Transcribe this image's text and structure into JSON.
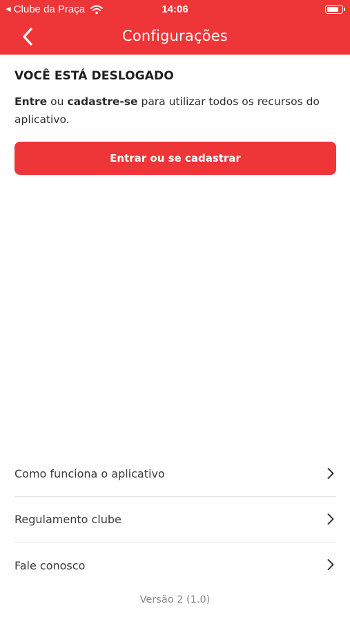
{
  "status_bar": {
    "back_app": "Clube da Praça",
    "time": "14:06",
    "battery_level": 0.85
  },
  "nav": {
    "title": "Configurações"
  },
  "logged_out": {
    "heading": "VOCÊ ESTÁ DESLOGADO",
    "desc_login": "Entre",
    "desc_or": " ou ",
    "desc_signup": "cadastre-se",
    "desc_rest": " para utilizar todos os recursos do aplicativo.",
    "button_label": "Entrar ou se cadastrar"
  },
  "menu": {
    "items": [
      {
        "label": "Como funciona o aplicativo"
      },
      {
        "label": "Regulamento clube"
      },
      {
        "label": "Fale conosco"
      }
    ]
  },
  "footer": {
    "version": "Versão 2 (1.0)"
  },
  "colors": {
    "brand": "#ee3537"
  }
}
